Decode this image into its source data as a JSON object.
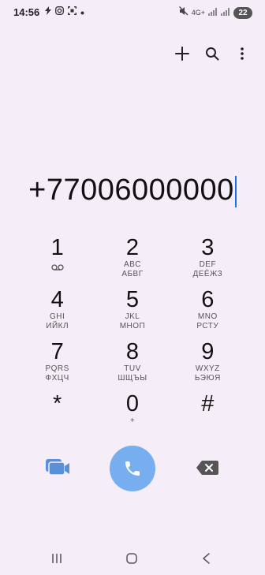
{
  "status_bar": {
    "time": "14:56",
    "left_icons": [
      "flash-icon",
      "instagram-icon",
      "screenshot-icon",
      "dot-icon"
    ],
    "network_type": "4G+",
    "battery_level": "22"
  },
  "toolbar": {
    "icons": [
      "add-icon",
      "search-icon",
      "more-vert-icon"
    ]
  },
  "dialer": {
    "number": "+77006000000"
  },
  "keypad": [
    {
      "digit": "1",
      "sub1": "",
      "sub2": ""
    },
    {
      "digit": "2",
      "sub1": "ABC",
      "sub2": "АБВГ"
    },
    {
      "digit": "3",
      "sub1": "DEF",
      "sub2": "ДЕЁЖЗ"
    },
    {
      "digit": "4",
      "sub1": "GHI",
      "sub2": "ИЙКЛ"
    },
    {
      "digit": "5",
      "sub1": "JKL",
      "sub2": "МНОП"
    },
    {
      "digit": "6",
      "sub1": "MNO",
      "sub2": "РСТУ"
    },
    {
      "digit": "7",
      "sub1": "PQRS",
      "sub2": "ФХЦЧ"
    },
    {
      "digit": "8",
      "sub1": "TUV",
      "sub2": "ШЩЪЫ"
    },
    {
      "digit": "9",
      "sub1": "WXYZ",
      "sub2": "ЬЭЮЯ"
    },
    {
      "digit": "*",
      "sub1": "",
      "sub2": ""
    },
    {
      "digit": "0",
      "sub1": "+",
      "sub2": ""
    },
    {
      "digit": "#",
      "sub1": "",
      "sub2": ""
    }
  ],
  "colors": {
    "background": "#f5eef8",
    "call_button": "#76aef0",
    "video_icon": "#5b8fd8",
    "cursor": "#1a73e8"
  }
}
